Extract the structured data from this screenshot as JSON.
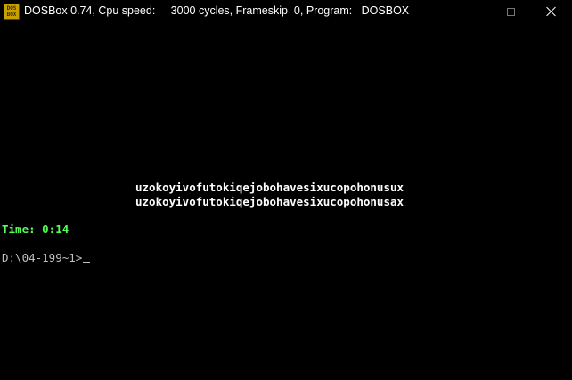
{
  "window": {
    "title": "DOSBox 0.74, Cpu speed:     3000 cycles, Frameskip  0, Program:   DOSBOX",
    "icon_text_top": "DOS",
    "icon_text_bottom": "BOX",
    "controls": [
      "minimize-icon",
      "maximize-icon",
      "close-icon"
    ]
  },
  "console": {
    "word_line_1": "uzokoyivofutokiqejobohavesixucopohonusux",
    "word_line_2": "uzokoyivofutokiqejobohavesixucopohonusax",
    "timer": "Time: 0:14",
    "prompt": "D:\\04-199~1>"
  },
  "colors": {
    "background": "#000000",
    "text": "#ffffff",
    "timer": "#55ff55",
    "prompt": "#c0c0c0"
  }
}
